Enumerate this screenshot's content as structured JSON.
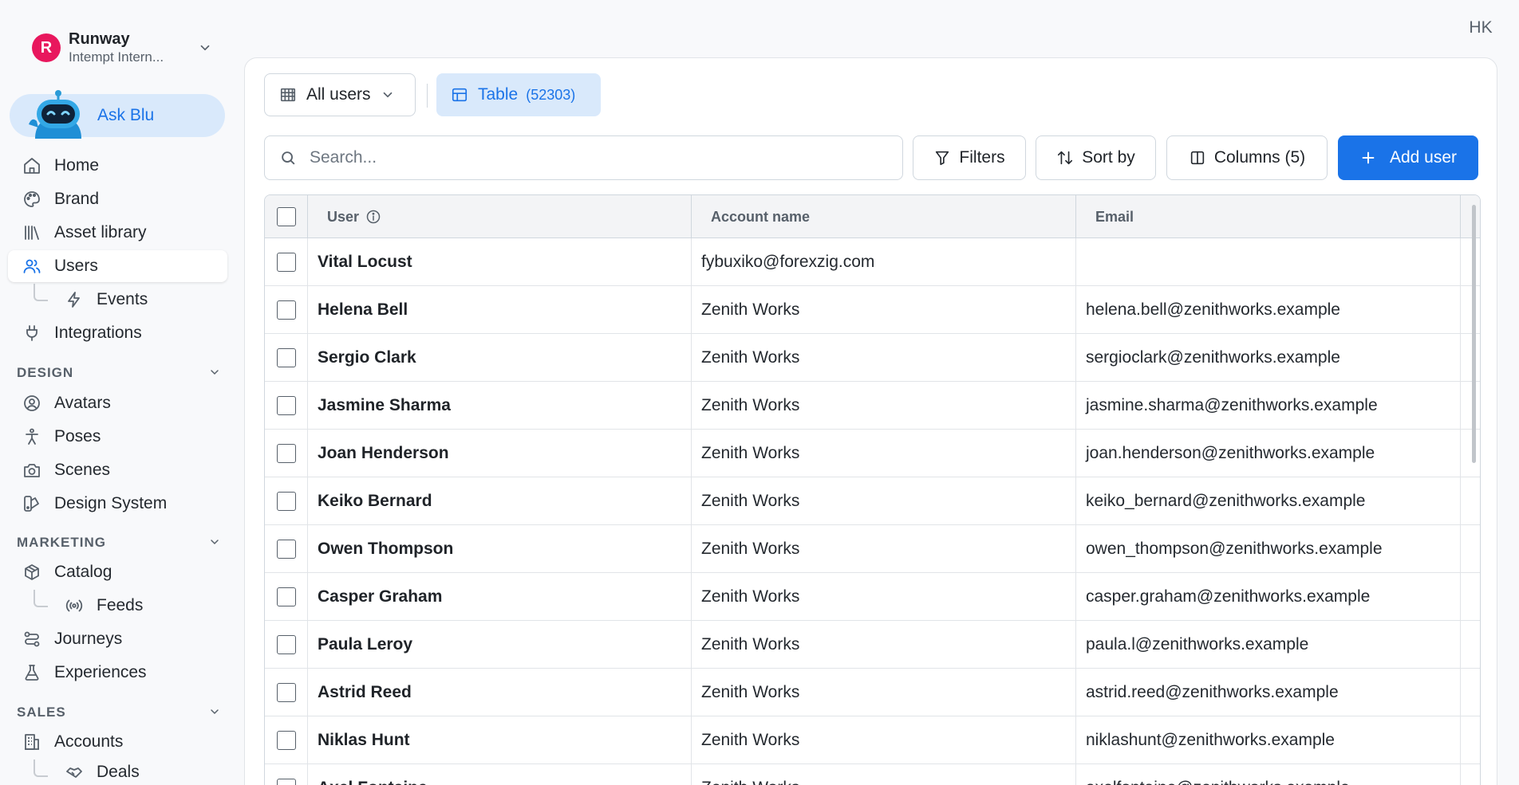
{
  "workspace": {
    "name": "Runway",
    "subtitle": "Intempt Intern...",
    "logo_letter": "R",
    "logo_color": "#e8175d"
  },
  "ask_blu": {
    "label": "Ask Blu"
  },
  "nav": {
    "home": "Home",
    "brand": "Brand",
    "asset_library": "Asset library",
    "users": "Users",
    "events": "Events",
    "integrations": "Integrations",
    "design_section": "DESIGN",
    "avatars": "Avatars",
    "poses": "Poses",
    "scenes": "Scenes",
    "design_system": "Design System",
    "marketing_section": "MARKETING",
    "catalog": "Catalog",
    "feeds": "Feeds",
    "journeys": "Journeys",
    "experiences": "Experiences",
    "sales_section": "SALES",
    "accounts": "Accounts",
    "deals": "Deals"
  },
  "user_initials": "HK",
  "toolbar": {
    "view_label": "All users",
    "table_label": "Table",
    "table_count": "(52303)",
    "search_placeholder": "Search...",
    "filters_label": "Filters",
    "sort_label": "Sort by",
    "columns_label": "Columns (5)",
    "add_user_label": "Add user"
  },
  "table": {
    "columns": [
      "User",
      "Account name",
      "Email"
    ],
    "rows": [
      {
        "user": "Vital Locust",
        "account": "fybuxiko@forexzig.com",
        "email": ""
      },
      {
        "user": "Helena Bell",
        "account": "Zenith Works",
        "email": "helena.bell@zenithworks.example"
      },
      {
        "user": "Sergio Clark",
        "account": "Zenith Works",
        "email": "sergioclark@zenithworks.example"
      },
      {
        "user": "Jasmine Sharma",
        "account": "Zenith Works",
        "email": "jasmine.sharma@zenithworks.example"
      },
      {
        "user": "Joan Henderson",
        "account": "Zenith Works",
        "email": "joan.henderson@zenithworks.example"
      },
      {
        "user": "Keiko Bernard",
        "account": "Zenith Works",
        "email": "keiko_bernard@zenithworks.example"
      },
      {
        "user": "Owen Thompson",
        "account": "Zenith Works",
        "email": "owen_thompson@zenithworks.example"
      },
      {
        "user": "Casper Graham",
        "account": "Zenith Works",
        "email": "casper.graham@zenithworks.example"
      },
      {
        "user": "Paula Leroy",
        "account": "Zenith Works",
        "email": "paula.l@zenithworks.example"
      },
      {
        "user": "Astrid Reed",
        "account": "Zenith Works",
        "email": "astrid.reed@zenithworks.example"
      },
      {
        "user": "Niklas Hunt",
        "account": "Zenith Works",
        "email": "niklashunt@zenithworks.example"
      },
      {
        "user": "Axel Fontaine",
        "account": "Zenith Works",
        "email": "axelfontaine@zenithworks.example"
      }
    ]
  },
  "colors": {
    "accent": "#1a73e8",
    "accent_soft": "#d9e9fb"
  }
}
